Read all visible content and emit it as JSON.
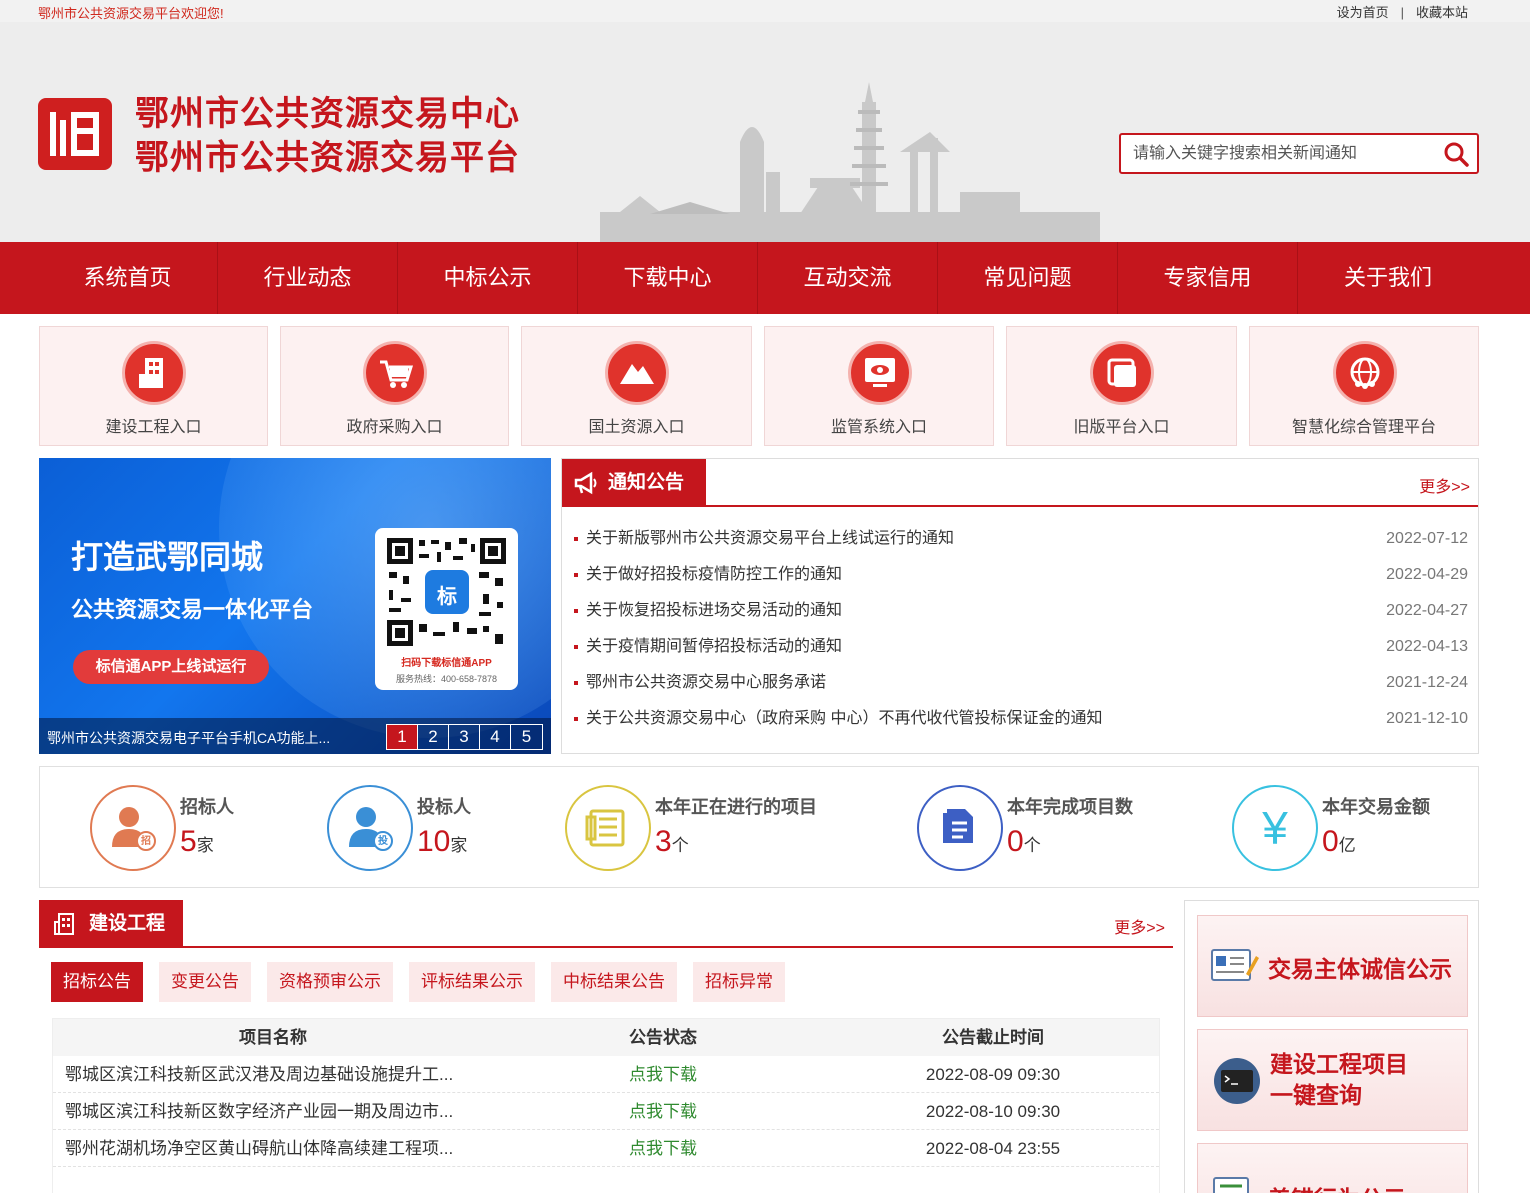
{
  "topbar": {
    "welcome": "鄂州市公共资源交易平台欢迎您!",
    "set_home": "设为首页",
    "separator": "|",
    "bookmark": "收藏本站"
  },
  "header": {
    "title_line1": "鄂州市公共资源交易中心",
    "title_line2": "鄂州市公共资源交易平台",
    "search_placeholder": "请输入关键字搜索相关新闻通知",
    "search_icon": "search-icon"
  },
  "nav": [
    "系统首页",
    "行业动态",
    "中标公示",
    "下载中心",
    "互动交流",
    "常见问题",
    "专家信用",
    "关于我们"
  ],
  "entries": [
    {
      "label": "建设工程入口",
      "icon": "building-icon"
    },
    {
      "label": "政府采购入口",
      "icon": "cart-icon"
    },
    {
      "label": "国土资源入口",
      "icon": "mountain-icon"
    },
    {
      "label": "监管系统入口",
      "icon": "monitor-icon"
    },
    {
      "label": "旧版平台入口",
      "icon": "window-icon"
    },
    {
      "label": "智慧化综合管理平台",
      "icon": "globe-icon"
    }
  ],
  "banner": {
    "headline": "打造武鄂同城",
    "subline": "公共资源交易一体化平台",
    "pill": "标信通APP上线试运行",
    "qr_caption": "扫码下载标信通APP",
    "qr_phone": "服务热线：400-658-7878",
    "qr_logo_char": "标",
    "caption": "鄂州市公共资源交易电子平台手机CA功能上...",
    "pages": [
      "1",
      "2",
      "3",
      "4",
      "5"
    ],
    "active_page": "1"
  },
  "notice": {
    "title": "通知公告",
    "more": "更多>>",
    "items": [
      {
        "title": "关于新版鄂州市公共资源交易平台上线试运行的通知",
        "date": "2022-07-12"
      },
      {
        "title": "关于做好招投标疫情防控工作的通知",
        "date": "2022-04-29"
      },
      {
        "title": "关于恢复招投标进场交易活动的通知",
        "date": "2022-04-27"
      },
      {
        "title": "关于疫情期间暂停招投标活动的通知",
        "date": "2022-04-13"
      },
      {
        "title": "鄂州市公共资源交易中心服务承诺",
        "date": "2021-12-24"
      },
      {
        "title": "关于公共资源交易中心（政府采购 中心）不再代收代管投标保证金的通知",
        "date": "2021-12-10"
      }
    ]
  },
  "stats": [
    {
      "title": "招标人",
      "value": "5",
      "unit": "家",
      "icon": "tenderer-icon",
      "badge": "招",
      "color": "#e07a52"
    },
    {
      "title": "投标人",
      "value": "10",
      "unit": "家",
      "icon": "bidder-icon",
      "badge": "投",
      "color": "#3a8fd6"
    },
    {
      "title": "本年正在进行的项目",
      "value": "3",
      "unit": "个",
      "icon": "document-icon",
      "color": "#d9c540"
    },
    {
      "title": "本年完成项目数",
      "value": "0",
      "unit": "个",
      "icon": "files-icon",
      "color": "#3d5fc4"
    },
    {
      "title": "本年交易金额",
      "value": "0",
      "unit": "亿",
      "icon": "yen-icon",
      "symbol": "¥",
      "color": "#38c1e0"
    }
  ],
  "construction": {
    "title": "建设工程",
    "more": "更多>>",
    "tabs": [
      "招标公告",
      "变更公告",
      "资格预审公示",
      "评标结果公示",
      "中标结果公告",
      "招标异常"
    ],
    "active_tab": "招标公告",
    "columns": [
      "项目名称",
      "公告状态",
      "公告截止时间"
    ],
    "rows": [
      {
        "name": "鄂城区滨江科技新区武汉港及周边基础设施提升工...",
        "status": "点我下载",
        "deadline": "2022-08-09 09:30"
      },
      {
        "name": "鄂城区滨江科技新区数字经济产业园一期及周边市...",
        "status": "点我下载",
        "deadline": "2022-08-10 09:30"
      },
      {
        "name": "鄂州花湖机场净空区黄山碍航山体降高续建工程项...",
        "status": "点我下载",
        "deadline": "2022-08-04 23:55"
      }
    ]
  },
  "side": [
    {
      "label": "交易主体诚信公示",
      "icon": "credit-icon"
    },
    {
      "label_line1": "建设工程项目",
      "label_line2": "一键查询",
      "icon": "terminal-icon"
    },
    {
      "label": "盖错行为公示",
      "icon": "notice-icon"
    }
  ],
  "colors": {
    "brand_red": "#c5161d",
    "nav_red": "#c5161d",
    "link_green": "#2f8a2f"
  }
}
